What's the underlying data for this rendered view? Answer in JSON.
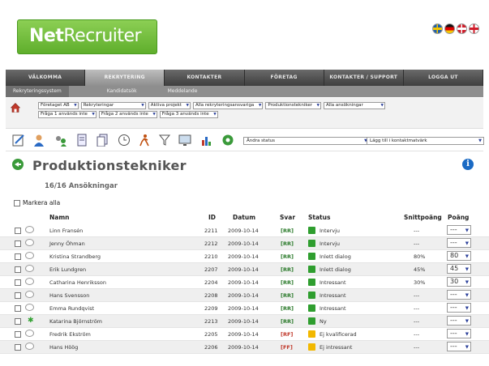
{
  "brand": {
    "logo_bold": "Net",
    "logo_rest": "Recruiter"
  },
  "flags": [
    "se",
    "de",
    "dk",
    "gb"
  ],
  "nav": {
    "tabs": [
      {
        "label": "VÄLKOMMA",
        "active": false
      },
      {
        "label": "REKRYTERING",
        "active": true
      },
      {
        "label": "KONTAKTER",
        "active": false
      },
      {
        "label": "FÖRETAG",
        "active": false
      },
      {
        "label": "KONTAKTER / SUPPORT",
        "active": false
      },
      {
        "label": "LOGGA UT",
        "active": false
      }
    ],
    "subtabs": [
      {
        "label": "Rekryteringssystem",
        "active": true
      },
      {
        "label": "Kandidatsök",
        "active": false
      },
      {
        "label": "Meddelande",
        "active": false
      }
    ]
  },
  "filters": {
    "row1": [
      "Företaget AB",
      "Rekryteringar",
      "Aktiva projekt",
      "Alla rekryteringsansvariga",
      "Produktionstekniker",
      "Alla ansökningar"
    ],
    "row2": [
      "Fråga 1 används inte",
      "Fråga 2 används inte",
      "Fråga 3 används inte"
    ]
  },
  "toolbar": {
    "icons": [
      "edit-icon",
      "person-icon",
      "group-icon",
      "document-icon",
      "documents-icon",
      "clock-icon",
      "running-person-icon",
      "filter-icon",
      "monitor-icon",
      "bar-chart-icon",
      "settings-gear-icon"
    ],
    "status_select": "Ändra status",
    "interview_select": "Lägg till i kontaktmatvärk"
  },
  "page": {
    "title": "Produktionstekniker",
    "count": "16/16 Ansökningar",
    "mark_all": "Markera alla"
  },
  "table": {
    "headers": {
      "name": "Namn",
      "id": "ID",
      "date": "Datum",
      "svar": "Svar",
      "status": "Status",
      "snitt": "Snittpoäng",
      "poang": "Poäng"
    },
    "rows": [
      {
        "name": "Linn Fransén",
        "id": "2211",
        "date": "2009-10-14",
        "svar": "[RR]",
        "status": "Intervju",
        "status_color": "#2f9e2f",
        "snitt": "---",
        "poang": "---",
        "new": false
      },
      {
        "name": "Jenny Öhman",
        "id": "2212",
        "date": "2009-10-14",
        "svar": "[RR]",
        "status": "Intervju",
        "status_color": "#2f9e2f",
        "snitt": "---",
        "poang": "---",
        "new": false
      },
      {
        "name": "Kristina Strandberg",
        "id": "2210",
        "date": "2009-10-14",
        "svar": "[RR]",
        "status": "Inlett dialog",
        "status_color": "#2f9e2f",
        "snitt": "80%",
        "poang": "80",
        "new": false
      },
      {
        "name": "Erik Lundgren",
        "id": "2207",
        "date": "2009-10-14",
        "svar": "[RR]",
        "status": "Inlett dialog",
        "status_color": "#2f9e2f",
        "snitt": "45%",
        "poang": "45",
        "new": false
      },
      {
        "name": "Catharina Henriksson",
        "id": "2204",
        "date": "2009-10-14",
        "svar": "[RR]",
        "status": "Intressant",
        "status_color": "#2f9e2f",
        "snitt": "30%",
        "poang": "30",
        "new": false
      },
      {
        "name": "Hans Svensson",
        "id": "2208",
        "date": "2009-10-14",
        "svar": "[RR]",
        "status": "Intressant",
        "status_color": "#2f9e2f",
        "snitt": "---",
        "poang": "---",
        "new": false
      },
      {
        "name": "Emma Rundqvist",
        "id": "2209",
        "date": "2009-10-14",
        "svar": "[RR]",
        "status": "Intressant",
        "status_color": "#2f9e2f",
        "snitt": "---",
        "poang": "---",
        "new": false
      },
      {
        "name": "Katarina Björnström",
        "id": "2213",
        "date": "2009-10-14",
        "svar": "[RR]",
        "status": "Ny",
        "status_color": "#2f9e2f",
        "snitt": "---",
        "poang": "---",
        "new": true
      },
      {
        "name": "Fredrik Ekström",
        "id": "2205",
        "date": "2009-10-14",
        "svar": "[RF]",
        "status": "Ej kvalificerad",
        "status_color": "#f2b800",
        "snitt": "---",
        "poang": "---",
        "new": false
      },
      {
        "name": "Hans Höög",
        "id": "2206",
        "date": "2009-10-14",
        "svar": "[FF]",
        "status": "Ej intressant",
        "status_color": "#f2b800",
        "snitt": "---",
        "poang": "---",
        "new": false
      }
    ]
  }
}
